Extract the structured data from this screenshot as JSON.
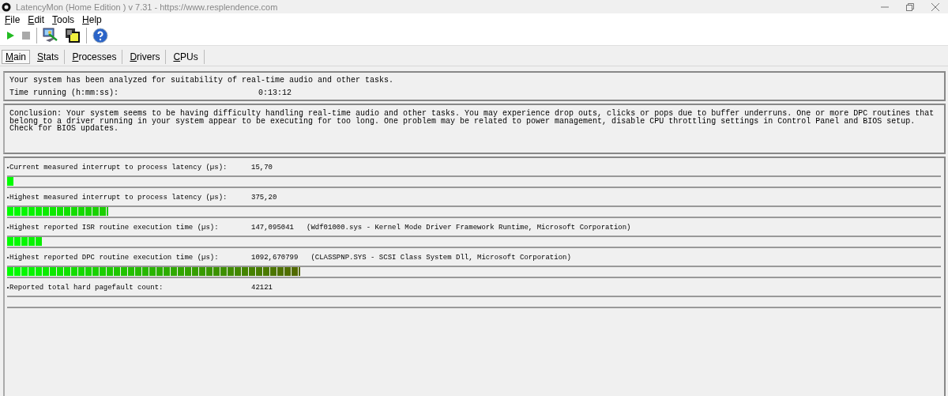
{
  "window": {
    "title": "LatencyMon  (Home Edition )  v 7.31 - https://www.resplendence.com"
  },
  "menu": [
    "File",
    "Edit",
    "Tools",
    "Help"
  ],
  "toolbar": [
    {
      "kind": "play",
      "disabled": false
    },
    {
      "kind": "stop",
      "disabled": true
    },
    {
      "kind": "sep"
    },
    {
      "kind": "monitor"
    },
    {
      "kind": "windows"
    },
    {
      "kind": "sep"
    },
    {
      "kind": "help"
    }
  ],
  "tabs": [
    {
      "label": "Main",
      "selected": true
    },
    {
      "label": "Stats",
      "selected": false
    },
    {
      "label": "Processes",
      "selected": false
    },
    {
      "label": "Drivers",
      "selected": false
    },
    {
      "label": "CPUs",
      "selected": false
    }
  ],
  "summary": {
    "message": "Your system has been analyzed for suitability of real-time audio and other tasks.",
    "time_label": "Time running (h:mm:ss):",
    "time_value": "0:13:12"
  },
  "conclusion": "Conclusion: Your system seems to be having difficulty handling real-time audio and other tasks. You may experience drop outs, clicks or pops due to buffer underruns. One or more DPC routines that belong to a driver running in your system appear to be executing for too long. One problem may be related to power management, disable CPU throttling settings in Control Panel and BIOS setup. Check for BIOS updates.",
  "metrics": [
    {
      "label": "Current measured interrupt to process latency (µs):",
      "value": "15,70",
      "level": 0.008
    },
    {
      "label": "Highest measured interrupt to process latency (µs):",
      "value": "375,20",
      "level": 0.108
    },
    {
      "label": "Highest reported ISR routine execution time (µs):",
      "value": "147,095041",
      "detail": "(Wdf01000.sys - Kernel Mode Driver Framework Runtime, Microsoft Corporation)",
      "level": 0.038
    },
    {
      "label": "Highest reported DPC routine execution time (µs):",
      "value": "1092,670799",
      "detail": "(CLASSPNP.SYS - SCSI Class System Dll, Microsoft Corporation)",
      "level": 0.314
    },
    {
      "label": "Reported total hard pagefault count:",
      "value": "42121",
      "level": 0
    }
  ]
}
